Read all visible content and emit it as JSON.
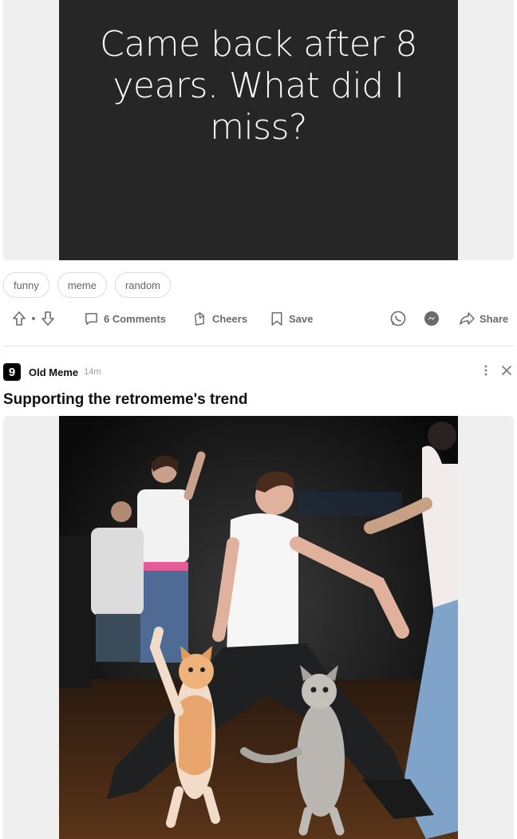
{
  "post1": {
    "image_text": "Came back after 8 years. What did I miss?",
    "tags": [
      "funny",
      "meme",
      "random"
    ],
    "actions": {
      "comments": "6 Comments",
      "cheers": "Cheers",
      "save": "Save",
      "share": "Share"
    }
  },
  "post2": {
    "section_logo": "9",
    "section": "Old Meme",
    "time": "14m",
    "title": "Supporting the retromeme's trend"
  },
  "icons": {
    "upvote": "arrow-up-icon",
    "downvote": "arrow-down-icon",
    "comment": "comment-icon",
    "cheers": "cheers-icon",
    "save": "bookmark-icon",
    "whatsapp": "whatsapp-icon",
    "messenger": "messenger-icon",
    "share": "share-arrow-icon",
    "more": "more-vertical-icon",
    "close": "close-icon"
  },
  "colors": {
    "meme_background": "#262626",
    "meme_text": "#fafafa",
    "action_grey": "#6b6b6b",
    "media_backdrop": "#efefef"
  }
}
